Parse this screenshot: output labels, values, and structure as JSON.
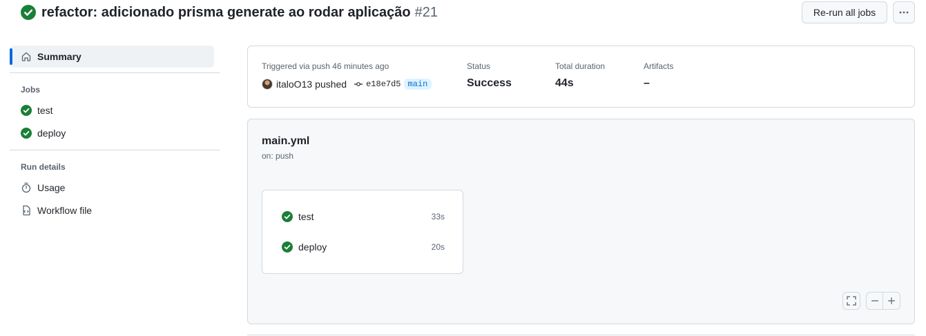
{
  "header": {
    "title": "refactor: adicionado prisma generate ao rodar aplicação",
    "run_number": "#21",
    "rerun_label": "Re-run all jobs",
    "status_icon": "check-circle-fill-icon"
  },
  "sidebar": {
    "summary_label": "Summary",
    "jobs_title": "Jobs",
    "jobs": [
      {
        "label": "test",
        "status": "success"
      },
      {
        "label": "deploy",
        "status": "success"
      }
    ],
    "run_details_title": "Run details",
    "run_details": [
      {
        "label": "Usage",
        "icon": "stopwatch-icon"
      },
      {
        "label": "Workflow file",
        "icon": "file-code-icon"
      }
    ]
  },
  "summary": {
    "triggered_label": "Triggered via push 46 minutes ago",
    "actor": "italoO13",
    "action": "pushed",
    "commit_sha": "e18e7d5",
    "branch": "main",
    "status_label": "Status",
    "status_value": "Success",
    "duration_label": "Total duration",
    "duration_value": "44s",
    "artifacts_label": "Artifacts",
    "artifacts_value": "–"
  },
  "workflow": {
    "file": "main.yml",
    "trigger": "on: push",
    "jobs": [
      {
        "label": "test",
        "duration": "33s"
      },
      {
        "label": "deploy",
        "duration": "20s"
      }
    ]
  },
  "colors": {
    "success": "#1a7f37",
    "accent": "#0969da",
    "border": "#d1d9e0",
    "muted_text": "#59636e"
  }
}
